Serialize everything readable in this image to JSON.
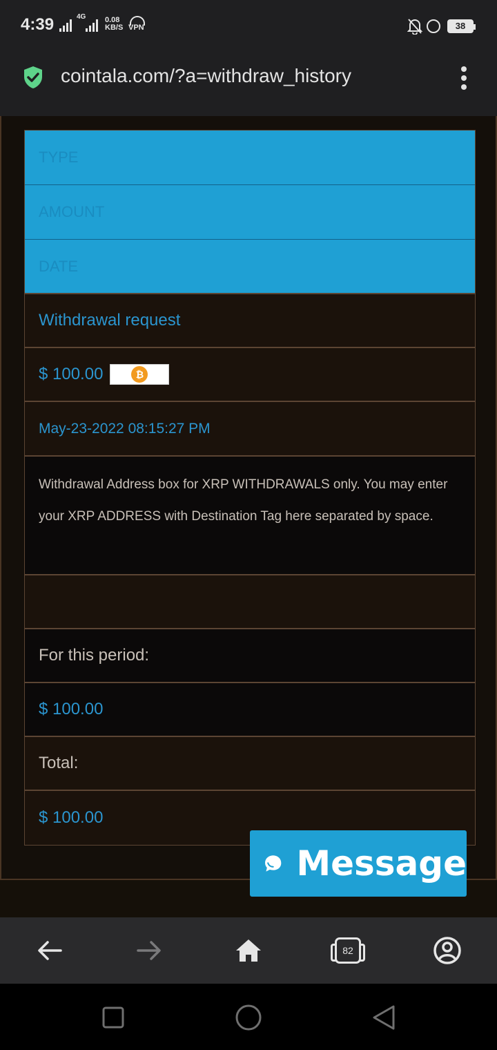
{
  "status_bar": {
    "time": "4:39",
    "network_type": "4G",
    "data_speed": "0.08",
    "data_speed_unit": "KB/S",
    "vpn_label": "VPN",
    "battery": "38"
  },
  "browser": {
    "url": "cointala.com/?a=withdraw_history",
    "tab_count": "82"
  },
  "table": {
    "headers": [
      "TYPE",
      "AMOUNT",
      "DATE"
    ],
    "entry": {
      "type": "Withdrawal request",
      "amount": "$ 100.00",
      "currency_icon": "bitcoin-icon",
      "date": "May-23-2022 08:15:27 PM"
    },
    "note": "Withdrawal Address box for XRP WITHDRAWALS only. You may enter your XRP ADDRESS with Destination Tag here separated by space.",
    "period_label": "For this period:",
    "period_amount": "$ 100.00",
    "total_label": "Total:",
    "total_amount": "$ 100.00"
  },
  "chat": {
    "button_label": "Message"
  },
  "colors": {
    "accent": "#1fa0d4",
    "link_blue": "#2b95cf",
    "border": "#5c4533",
    "secure_green": "#5ed38a"
  }
}
